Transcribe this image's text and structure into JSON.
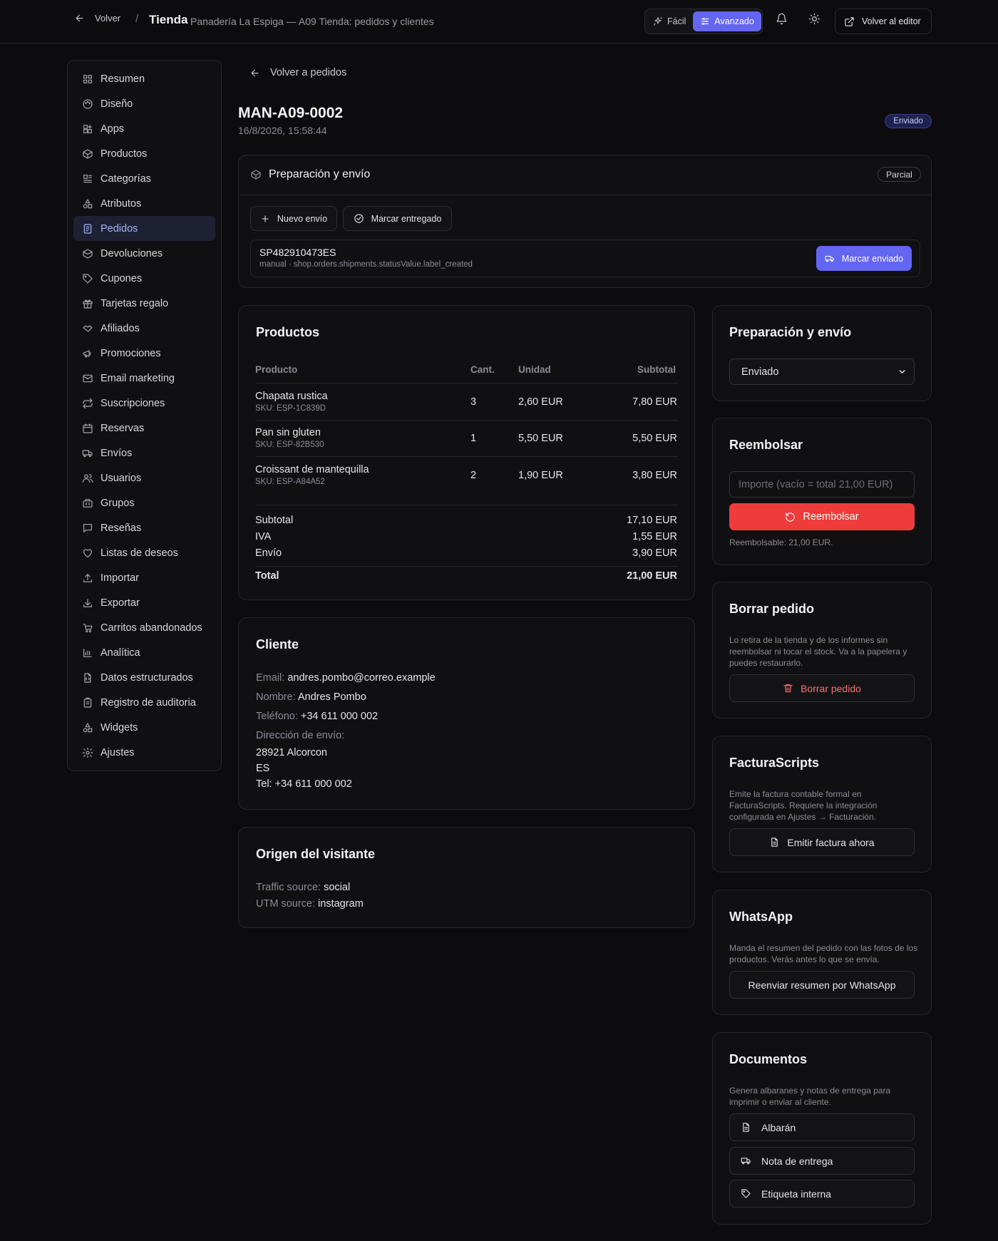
{
  "topbar": {
    "back_label": "Volver",
    "separator": "/",
    "title": "Tienda",
    "subtitle": "Panadería La Espiga — A09 Tienda: pedidos y clientes",
    "mode_easy": "Fácil",
    "mode_advanced": "Avanzado",
    "editor_label": "Volver al editor"
  },
  "sidebar": {
    "items": [
      {
        "label": "Resumen",
        "icon": "grid-icon"
      },
      {
        "label": "Diseño",
        "icon": "palette-icon"
      },
      {
        "label": "Apps",
        "icon": "apps-icon"
      },
      {
        "label": "Productos",
        "icon": "box-icon"
      },
      {
        "label": "Categorías",
        "icon": "categories-icon"
      },
      {
        "label": "Atributos",
        "icon": "shapes-icon"
      },
      {
        "label": "Pedidos",
        "icon": "receipt-icon",
        "active": true
      },
      {
        "label": "Devoluciones",
        "icon": "package-return-icon"
      },
      {
        "label": "Cupones",
        "icon": "tag-icon"
      },
      {
        "label": "Tarjetas regalo",
        "icon": "gift-icon"
      },
      {
        "label": "Afiliados",
        "icon": "handshake-icon"
      },
      {
        "label": "Promociones",
        "icon": "megaphone-icon"
      },
      {
        "label": "Email marketing",
        "icon": "mail-icon"
      },
      {
        "label": "Suscripciones",
        "icon": "repeat-icon"
      },
      {
        "label": "Reservas",
        "icon": "calendar-icon"
      },
      {
        "label": "Envíos",
        "icon": "truck-icon"
      },
      {
        "label": "Usuarios",
        "icon": "users-icon"
      },
      {
        "label": "Grupos",
        "icon": "groups-icon"
      },
      {
        "label": "Reseñas",
        "icon": "message-icon"
      },
      {
        "label": "Listas de deseos",
        "icon": "heart-icon"
      },
      {
        "label": "Importar",
        "icon": "upload-icon"
      },
      {
        "label": "Exportar",
        "icon": "download-icon"
      },
      {
        "label": "Carritos abandonados",
        "icon": "cart-icon"
      },
      {
        "label": "Analítica",
        "icon": "bar-chart-icon"
      },
      {
        "label": "Datos estructurados",
        "icon": "file-code-icon"
      },
      {
        "label": "Registro de auditoria",
        "icon": "clipboard-icon"
      },
      {
        "label": "Widgets",
        "icon": "widgets-icon"
      },
      {
        "label": "Ajustes",
        "icon": "gear-icon"
      }
    ]
  },
  "order": {
    "back_label": "Volver a pedidos",
    "id": "MAN-A09-0002",
    "date": "16/8/2026, 15:58:44",
    "status": "Enviado"
  },
  "shipping_panel": {
    "title": "Preparación y envío",
    "badge": "Parcial",
    "new_shipment": "Nuevo envío",
    "mark_delivered": "Marcar entregado",
    "tracking": "SP482910473ES",
    "tracking_meta": "manual · shop.orders.shipments.statusValue.label_created",
    "mark_sent": "Marcar enviado"
  },
  "products": {
    "title": "Productos",
    "headers": [
      "Producto",
      "Cant.",
      "Unidad",
      "Subtotal"
    ],
    "rows": [
      {
        "name": "Chapata rustica",
        "sku": "SKU: ESP-1C839D",
        "qty": "3",
        "unit": "2,60 EUR",
        "subtotal": "7,80 EUR"
      },
      {
        "name": "Pan sin gluten",
        "sku": "SKU: ESP-82B530",
        "qty": "1",
        "unit": "5,50 EUR",
        "subtotal": "5,50 EUR"
      },
      {
        "name": "Croissant de mantequilla",
        "sku": "SKU: ESP-A84A52",
        "qty": "2",
        "unit": "1,90 EUR",
        "subtotal": "3,80 EUR"
      }
    ],
    "totals": {
      "subtotal_label": "Subtotal",
      "subtotal": "17,10 EUR",
      "tax_label": "IVA",
      "tax": "1,55 EUR",
      "shipping_label": "Envío",
      "shipping": "3,90 EUR",
      "total_label": "Total",
      "total": "21,00 EUR"
    }
  },
  "customer": {
    "title": "Cliente",
    "email_label": "Email:",
    "email": "andres.pombo@correo.example",
    "name_label": "Nombre:",
    "name": "Andres Pombo",
    "phone_label": "Teléfono:",
    "phone": "+34 611 000 002",
    "address_label": "Dirección de envío:",
    "address_line1": "28921 Alcorcon",
    "address_line2": "ES",
    "address_line3": "Tel: +34 611 000 002"
  },
  "visitor": {
    "title": "Origen del visitante",
    "traffic_label": "Traffic source:",
    "traffic": "social",
    "utm_label": "UTM source:",
    "utm": "instagram"
  },
  "status_card": {
    "title": "Preparación y envío",
    "selected": "Enviado"
  },
  "refund": {
    "title": "Reembolsar",
    "placeholder": "Importe (vacío = total 21,00 EUR)",
    "button": "Reembolsar",
    "note": "Reembolsable: 21,00 EUR."
  },
  "delete": {
    "title": "Borrar pedido",
    "description": "Lo retira de la tienda y de los informes sin reembolsar ni tocar el stock. Va a la papelera y puedes restaurarlo.",
    "button": "Borrar pedido"
  },
  "invoice": {
    "title": "FacturaScripts",
    "description": "Emite la factura contable formal en FacturaScripts. Requiere la integración configurada en Ajustes → Facturación.",
    "button": "Emitir factura ahora"
  },
  "whatsapp": {
    "title": "WhatsApp",
    "description": "Manda el resumen del pedido con las fotos de los productos. Verás antes lo que se envía.",
    "button": "Reenviar resumen por WhatsApp"
  },
  "documents": {
    "title": "Documentos",
    "description": "Genera albaranes y notas de entrega para imprimir o enviar al cliente.",
    "albaran": "Albarán",
    "delivery_note": "Nota de entrega",
    "internal_label": "Etiqueta interna"
  },
  "colors": {
    "accent": "#6366f1",
    "danger": "#ef3b3b",
    "background": "#0c0c0f"
  }
}
